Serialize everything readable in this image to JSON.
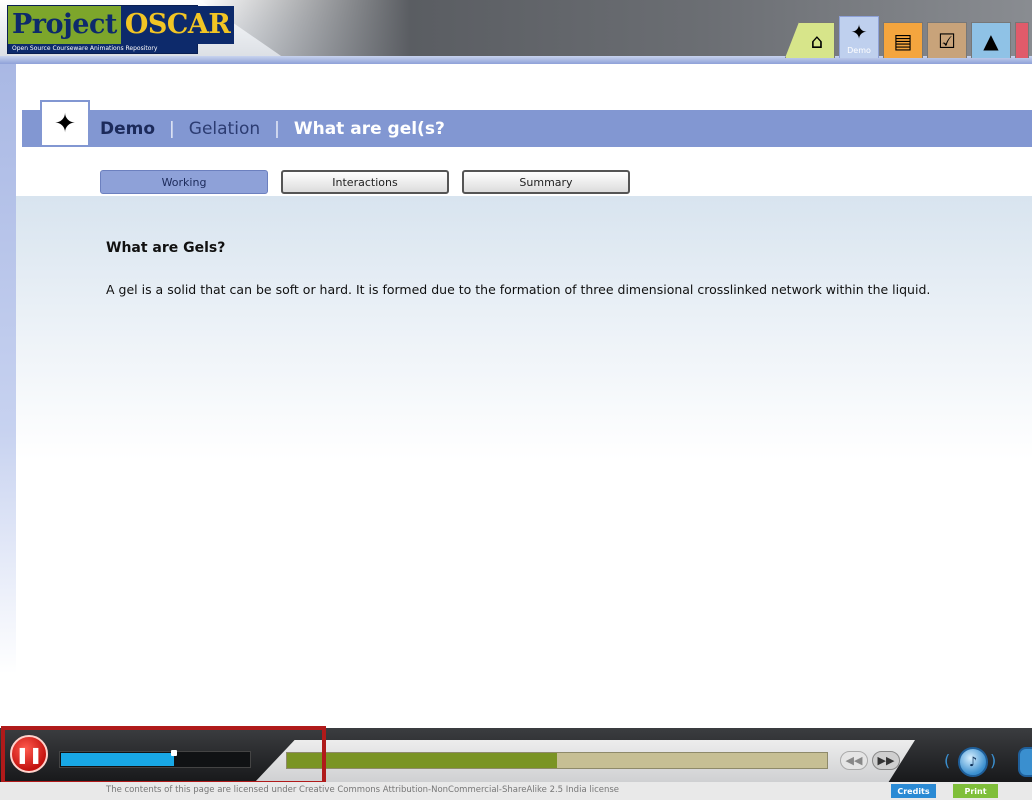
{
  "logo": {
    "word_a": "Project",
    "word_b": "OSCAR",
    "subtitle": "Open Source Courseware Animations Repository"
  },
  "nav": {
    "tabs": [
      {
        "icon": "home-icon"
      },
      {
        "icon": "cursor-click-icon",
        "label": "Demo"
      },
      {
        "icon": "book-icon"
      },
      {
        "icon": "checklist-icon"
      },
      {
        "icon": "graduation-cap-icon"
      }
    ]
  },
  "breadcrumb": {
    "section": "Demo",
    "topic": "Gelation",
    "current": "What are gel(s?"
  },
  "subtabs": [
    {
      "label": "Working",
      "active": true
    },
    {
      "label": "Interactions",
      "active": false
    },
    {
      "label": "Summary",
      "active": false
    }
  ],
  "content": {
    "heading": "What are Gels?",
    "body": "A gel is a solid that can be soft or hard. It is formed due to the formation of three dimensional crosslinked network within the liquid."
  },
  "player": {
    "audio_level": 0.6,
    "progress": 0.5,
    "prev_icon": "rewind-icon",
    "next_icon": "fast-forward-icon",
    "volume_icon": "speaker-icon",
    "pause_icon": "pause-icon"
  },
  "footer": {
    "license_text": "The contents of this page are licensed under Creative Commons Attribution-NonCommercial-ShareAlike 2.5 India license",
    "credits_label": "Credits",
    "print_label": "Print"
  },
  "colors": {
    "brand_blue": "#8297d2",
    "highlight_red": "#b01a1a",
    "progress_green": "#7a9423",
    "audio_blue": "#18a8e6"
  }
}
